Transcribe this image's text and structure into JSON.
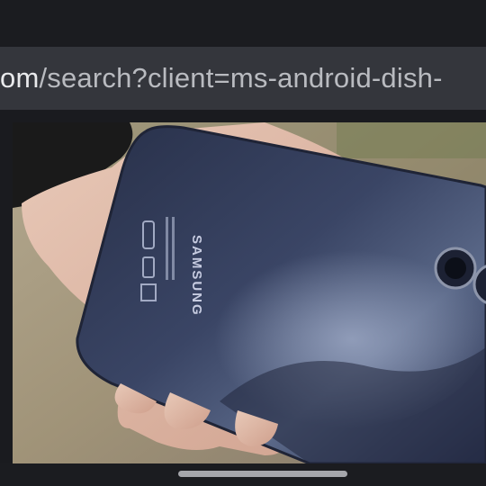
{
  "browser": {
    "url_domain_fragment": "om",
    "url_path": "/search?client=ms-android-dish-"
  },
  "photo": {
    "subject": "phone-back-image",
    "brand_text": "SAMSUNG",
    "phone_color": "#2c3550",
    "background_color": "#9c8f78"
  },
  "system": {
    "home_indicator": "home-indicator"
  }
}
